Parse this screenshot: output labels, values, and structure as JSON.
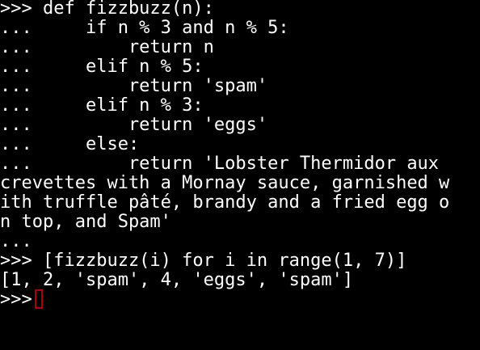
{
  "terminal": {
    "cursor_color": "#b00000",
    "lines": [
      ">>> def fizzbuzz(n):",
      "...     if n % 3 and n % 5:",
      "...         return n",
      "...     elif n % 5:",
      "...         return 'spam'",
      "...     elif n % 3:",
      "...         return 'eggs'",
      "...     else:",
      "...         return 'Lobster Thermidor aux",
      "crevettes with a Mornay sauce, garnished w",
      "ith truffle pâté, brandy and a fried egg o",
      "n top, and Spam'",
      "...",
      ">>> [fizzbuzz(i) for i in range(1, 7)]",
      "[1, 2, 'spam', 4, 'eggs', 'spam']"
    ],
    "prompt": ">>>"
  }
}
